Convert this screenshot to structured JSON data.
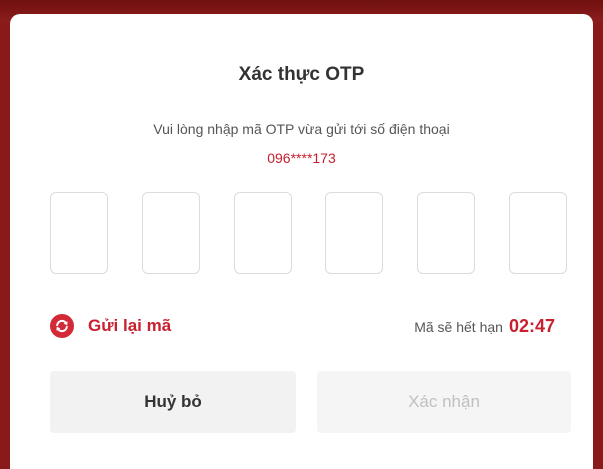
{
  "dialog": {
    "title": "Xác thực OTP",
    "instruction": "Vui lòng nhập mã OTP vừa gửi tới số điện thoại",
    "phone_masked": "096****173",
    "otp_boxes": [
      "",
      "",
      "",
      "",
      "",
      ""
    ]
  },
  "resend": {
    "label": "Gửi lại mã",
    "icon": "refresh-icon"
  },
  "expiry": {
    "label": "Mã sẽ hết hạn",
    "timer": "02:47"
  },
  "buttons": {
    "cancel_label": "Huỷ bỏ",
    "confirm_label": "Xác nhận",
    "confirm_enabled": false
  },
  "colors": {
    "accent": "#c8202f",
    "backdrop": "#8a1a1a",
    "disabled_text": "#c0c0c0"
  }
}
